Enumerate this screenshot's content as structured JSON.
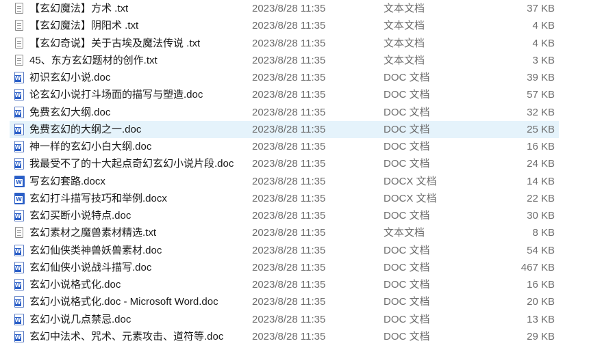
{
  "files": [
    {
      "name": "【玄幻魔法】方术 .txt",
      "modified": "2023/8/28 11:35",
      "type": "文本文档",
      "size": "37 KB",
      "icon": "text-file-icon"
    },
    {
      "name": "【玄幻魔法】阴阳术 .txt",
      "modified": "2023/8/28 11:35",
      "type": "文本文档",
      "size": "4 KB",
      "icon": "text-file-icon"
    },
    {
      "name": "【玄幻奇说】关于古埃及魔法传说 .txt",
      "modified": "2023/8/28 11:35",
      "type": "文本文档",
      "size": "4 KB",
      "icon": "text-file-icon"
    },
    {
      "name": "45、东方玄幻题材的创作.txt",
      "modified": "2023/8/28 11:35",
      "type": "文本文档",
      "size": "3 KB",
      "icon": "text-file-icon"
    },
    {
      "name": "初识玄幻小说.doc",
      "modified": "2023/8/28 11:35",
      "type": "DOC 文档",
      "size": "39 KB",
      "icon": "word-doc-icon"
    },
    {
      "name": "论玄幻小说打斗场面的描写与塑造.doc",
      "modified": "2023/8/28 11:35",
      "type": "DOC 文档",
      "size": "57 KB",
      "icon": "word-doc-icon"
    },
    {
      "name": "免费玄幻大纲.doc",
      "modified": "2023/8/28 11:35",
      "type": "DOC 文档",
      "size": "32 KB",
      "icon": "word-doc-icon"
    },
    {
      "name": "免费玄幻的大纲之一.doc",
      "modified": "2023/8/28 11:35",
      "type": "DOC 文档",
      "size": "25 KB",
      "icon": "word-doc-icon",
      "hovered": true
    },
    {
      "name": "神一样的玄幻小白大纲.doc",
      "modified": "2023/8/28 11:35",
      "type": "DOC 文档",
      "size": "16 KB",
      "icon": "word-doc-icon"
    },
    {
      "name": "我最受不了的十大起点奇幻玄幻小说片段.doc",
      "modified": "2023/8/28 11:35",
      "type": "DOC 文档",
      "size": "24 KB",
      "icon": "word-doc-icon"
    },
    {
      "name": "写玄幻套路.docx",
      "modified": "2023/8/28 11:35",
      "type": "DOCX 文档",
      "size": "14 KB",
      "icon": "word-docx-icon"
    },
    {
      "name": "玄幻打斗描写技巧和举例.docx",
      "modified": "2023/8/28 11:35",
      "type": "DOCX 文档",
      "size": "22 KB",
      "icon": "word-docx-icon"
    },
    {
      "name": "玄幻买断小说特点.doc",
      "modified": "2023/8/28 11:35",
      "type": "DOC 文档",
      "size": "30 KB",
      "icon": "word-doc-icon"
    },
    {
      "name": "玄幻素材之魔兽素材精选.txt",
      "modified": "2023/8/28 11:35",
      "type": "文本文档",
      "size": "8 KB",
      "icon": "text-file-icon"
    },
    {
      "name": "玄幻仙侠类神兽妖兽素材.doc",
      "modified": "2023/8/28 11:35",
      "type": "DOC 文档",
      "size": "54 KB",
      "icon": "word-doc-icon"
    },
    {
      "name": "玄幻仙侠小说战斗描写.doc",
      "modified": "2023/8/28 11:35",
      "type": "DOC 文档",
      "size": "467 KB",
      "icon": "word-doc-icon"
    },
    {
      "name": "玄幻小说格式化.doc",
      "modified": "2023/8/28 11:35",
      "type": "DOC 文档",
      "size": "16 KB",
      "icon": "word-doc-icon"
    },
    {
      "name": "玄幻小说格式化.doc - Microsoft Word.doc",
      "modified": "2023/8/28 11:35",
      "type": "DOC 文档",
      "size": "20 KB",
      "icon": "word-doc-icon"
    },
    {
      "name": "玄幻小说几点禁忌.doc",
      "modified": "2023/8/28 11:35",
      "type": "DOC 文档",
      "size": "13 KB",
      "icon": "word-doc-icon"
    },
    {
      "name": "玄幻中法术、咒术、元素攻击、道符等.doc",
      "modified": "2023/8/28 11:35",
      "type": "DOC 文档",
      "size": "29 KB",
      "icon": "word-doc-icon"
    }
  ],
  "colors": {
    "hover_row": "#e5f3fb",
    "secondary_text": "#6d6d6d",
    "word_blue": "#2b5fc7"
  }
}
